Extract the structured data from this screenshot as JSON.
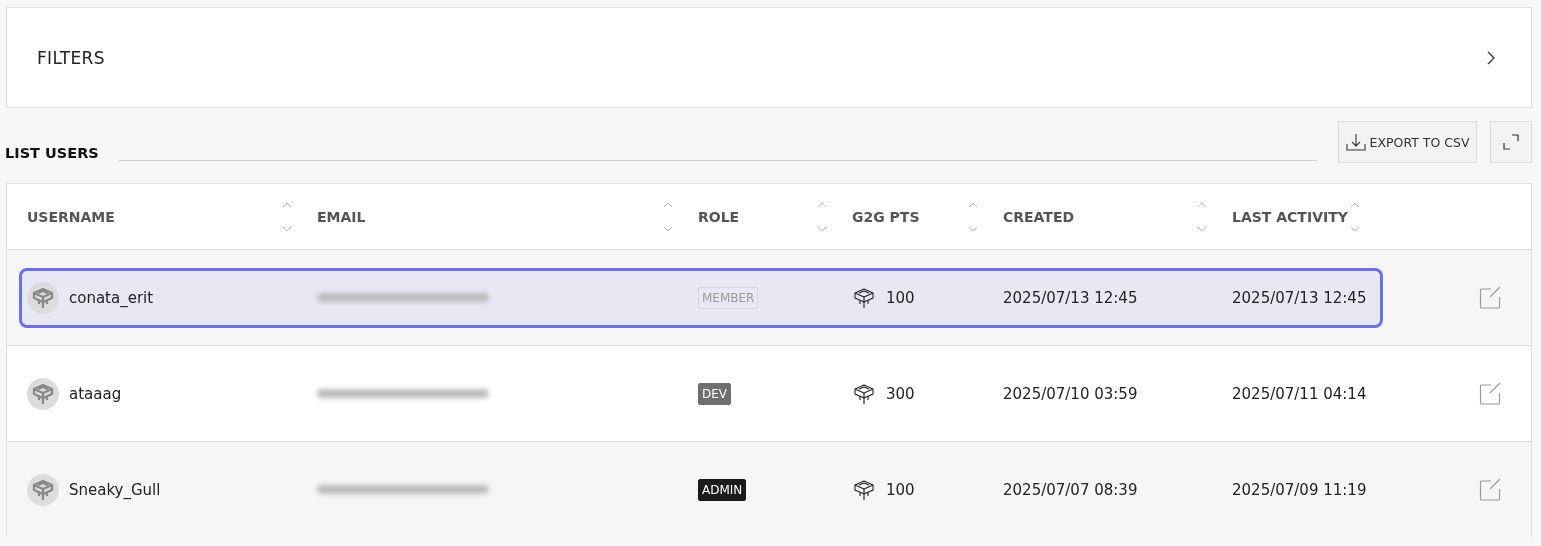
{
  "filters": {
    "label": "FILTERS"
  },
  "list": {
    "title": "LIST USERS",
    "export_button": "EXPORT TO CSV"
  },
  "table": {
    "columns": [
      "USERNAME",
      "EMAIL",
      "ROLE",
      "G2G PTS",
      "CREATED",
      "LAST ACTIVITY"
    ],
    "rows": [
      {
        "username": "conata_erit",
        "email_redacted": true,
        "role": {
          "label": "MEMBER",
          "kind": "member"
        },
        "points": "100",
        "created": "2025/07/13 12:45",
        "last_activity": "2025/07/13 12:45",
        "selected": true
      },
      {
        "username": "ataaag",
        "email_redacted": true,
        "role": {
          "label": "DEV",
          "kind": "dev"
        },
        "points": "300",
        "created": "2025/07/10 03:59",
        "last_activity": "2025/07/11 04:14",
        "selected": false
      },
      {
        "username": "Sneaky_Gull",
        "email_redacted": true,
        "role": {
          "label": "ADMIN",
          "kind": "admin"
        },
        "points": "100",
        "created": "2025/07/07 08:39",
        "last_activity": "2025/07/09 11:19",
        "selected": false
      }
    ]
  }
}
